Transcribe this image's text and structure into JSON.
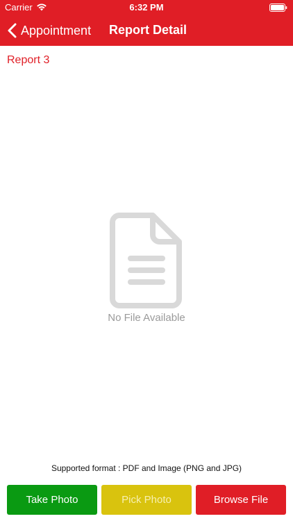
{
  "status_bar": {
    "carrier": "Carrier",
    "time": "6:32 PM"
  },
  "nav": {
    "back_label": "Appointment",
    "title": "Report Detail"
  },
  "report": {
    "name": "Report 3"
  },
  "empty_state": {
    "message": "No File Available",
    "icon": "document-icon"
  },
  "footer": {
    "supported_format": "Supported format : PDF and Image (PNG and JPG)"
  },
  "actions": {
    "take_photo": "Take Photo",
    "pick_photo": "Pick Photo",
    "browse_file": "Browse File"
  },
  "colors": {
    "brand_red": "#e01e26",
    "take_green": "#0a9a12",
    "pick_yellow": "#d9c30e",
    "muted_gray": "#9a9a9a"
  }
}
